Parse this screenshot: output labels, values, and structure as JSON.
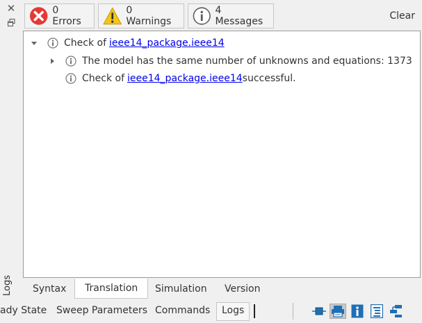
{
  "dock": {
    "close_glyph": "✕",
    "vertical_label": "Logs"
  },
  "toolbar": {
    "errors_label": "0 Errors",
    "warnings_label": "0 Warnings",
    "messages_label": "4 Messages",
    "clear_label": "Clear",
    "icons": [
      "error-icon",
      "warning-icon",
      "info-icon"
    ],
    "colors": {
      "error": "#e53935",
      "warning": "#f5c518",
      "info": "#5a5a5a",
      "link": "#0000ee"
    }
  },
  "log": {
    "entries": [
      {
        "prefix": "Check of ",
        "link": "ieee14_package.ieee14",
        "suffix": "",
        "expanded": true
      },
      {
        "text": "The model has the same number of unknowns and equations: 1373",
        "expanded": false
      },
      {
        "prefix": "Check of ",
        "link": "ieee14_package.ieee14",
        "suffix": " successful."
      }
    ]
  },
  "tabs_top": {
    "items": [
      "Syntax",
      "Translation",
      "Simulation",
      "Version"
    ],
    "active": "Translation"
  },
  "tabs_bottom": {
    "items": [
      "ady State",
      "Sweep Parameters",
      "Commands",
      "Logs"
    ],
    "active": "Logs"
  },
  "perspectives": {
    "icons": [
      "modeling-perspective-icon",
      "plotting-perspective-icon",
      "documentation-icon",
      "debugging-icon",
      "transformational-debugger-icon"
    ],
    "active": "plotting-perspective-icon"
  }
}
